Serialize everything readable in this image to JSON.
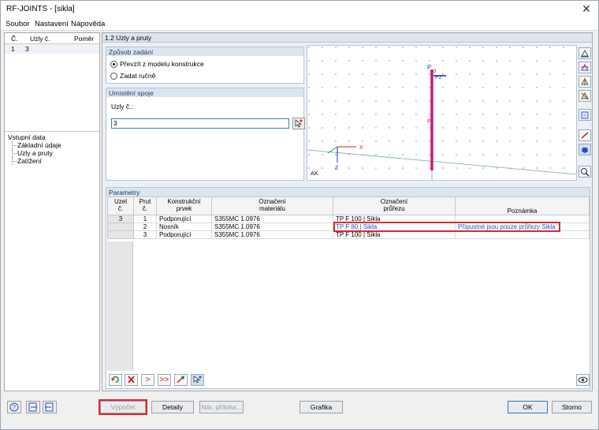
{
  "window": {
    "title": "RF-JOINTS - [sikla]",
    "close_glyph": "✕"
  },
  "menu": [
    "Soubor",
    "Nastavení",
    "Nápověda"
  ],
  "nodelist": {
    "headers": [
      "Č.",
      "Uzly č.",
      "Poměr"
    ],
    "rows": [
      {
        "no": "1",
        "nodes": "3",
        "ratio": ""
      }
    ]
  },
  "tree": {
    "root": "Vstupní data",
    "children": [
      "Základní údaje",
      "Uzly a pruty",
      "Zatížení"
    ]
  },
  "panel": {
    "title": "1.2 Uzly a pruty"
  },
  "input_method": {
    "title": "Způsob zadání",
    "options": [
      "Převzít z modelu konstrukce",
      "Zadat ručně"
    ],
    "selected": 0
  },
  "location": {
    "title": "Umístění spoje",
    "label": "Uzly č.:",
    "value": "3"
  },
  "viewport": {
    "labels": {
      "node": "P",
      "node_no": "3",
      "member": "P2",
      "axis_x": "X",
      "axis_z": "Z",
      "corner": "AK",
      "member_mid": "P1"
    }
  },
  "params": {
    "title": "Parametry",
    "headers": {
      "node": [
        "Uzel",
        "č."
      ],
      "member": [
        "Prut",
        "č."
      ],
      "element": [
        "Konstrukční",
        "prvek"
      ],
      "material": [
        "Označení",
        "materiálu"
      ],
      "section": [
        "Označení",
        "průřezu"
      ],
      "note": "Poznámka"
    },
    "rows": [
      {
        "node": "3",
        "member": "1",
        "element": "Podporující",
        "material": "S355MC 1.0976",
        "section": "TP F 100 | Sikla",
        "note": ""
      },
      {
        "node": "",
        "member": "2",
        "element": "Nosník",
        "material": "S355MC 1.0976",
        "section": "TP F 80 | Sikla",
        "note": "Přípustné jsou pouze průřezy Sikla"
      },
      {
        "node": "",
        "member": "3",
        "element": "Podporující",
        "material": "S355MC 1.0976",
        "section": "TP F 100 | Sikla",
        "note": ""
      }
    ],
    "highlight_color": "#e0262e"
  },
  "bottom": {
    "calc": "Výpočet",
    "details": "Detaily",
    "report": "Nár. příloha...",
    "graphics": "Grafika",
    "ok": "OK",
    "cancel": "Storno"
  }
}
